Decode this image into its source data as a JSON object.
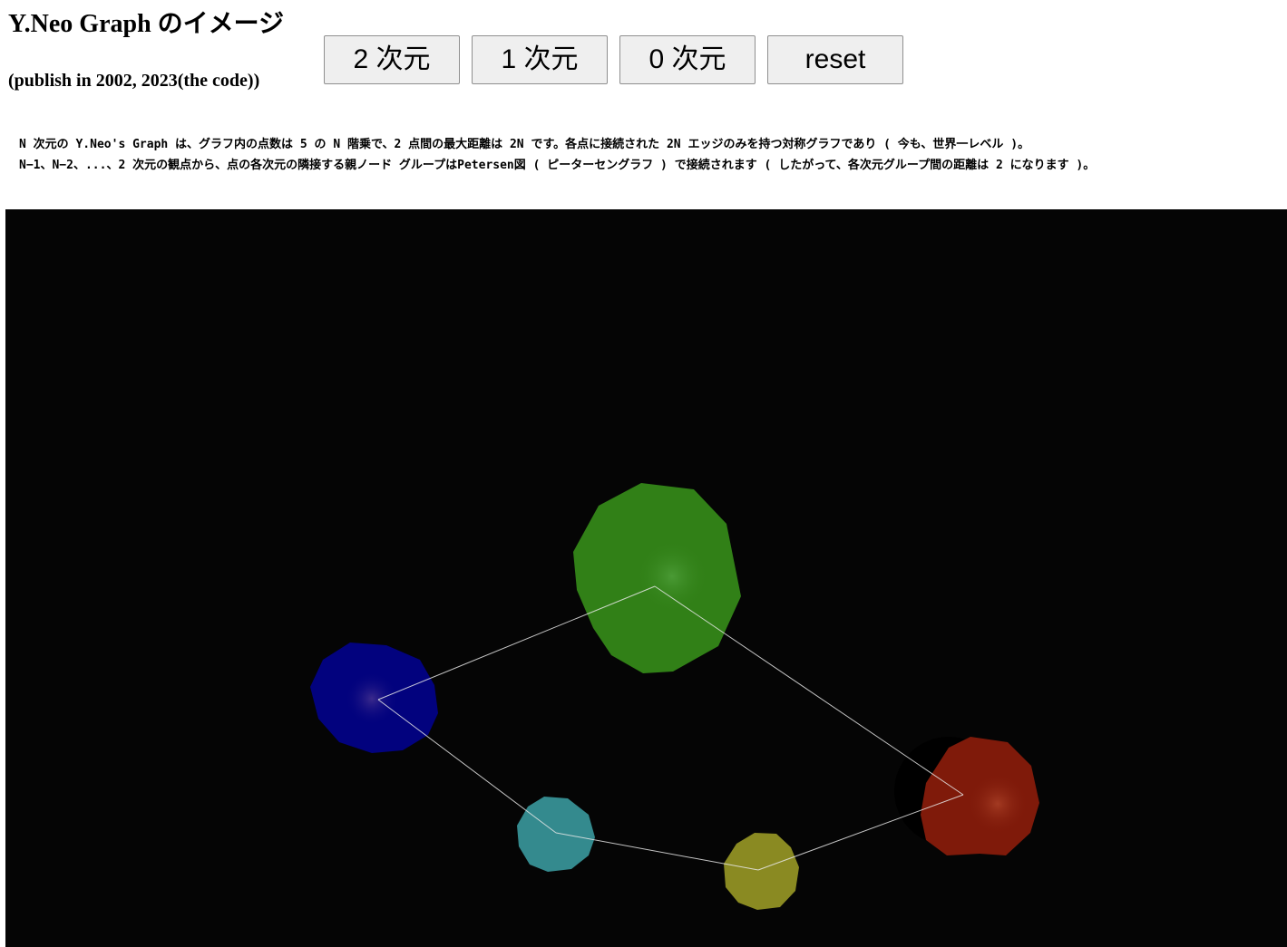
{
  "header": {
    "title": "Y.Neo Graph のイメージ",
    "subtitle": "(publish in 2002, 2023(the code))"
  },
  "controls": {
    "buttons": [
      {
        "label": "2 次元"
      },
      {
        "label": "1 次元"
      },
      {
        "label": "0 次元"
      },
      {
        "label": "reset"
      }
    ]
  },
  "description": {
    "line1": "N 次元の Y.Neo's Graph は、グラフ内の点数は 5 の N 階乗で、2 点間の最大距離は 2N です。各点に接続された 2N エッジのみを持つ対称グラフであり ( 今も、世界一レベル )。",
    "line2": "N−1、N−2、...、2 次元の観点から、点の各次元の隣接する親ノード グループはPetersen図 ( ピーターセングラフ ) で接続されます ( したがって、各次元グループ間の距離は 2 になります )。"
  },
  "graph": {
    "background": "#050505",
    "edge_color": "#e8e8e8",
    "nodes": [
      {
        "id": "green",
        "color": "#318017"
      },
      {
        "id": "blue",
        "color": "#02027e"
      },
      {
        "id": "cyan",
        "color": "#348a8e"
      },
      {
        "id": "yellow",
        "color": "#8a8a22"
      },
      {
        "id": "red",
        "color": "#7f1a0a"
      }
    ],
    "edges": [
      [
        "green",
        "blue"
      ],
      [
        "blue",
        "cyan"
      ],
      [
        "cyan",
        "yellow"
      ],
      [
        "yellow",
        "red"
      ],
      [
        "red",
        "green"
      ]
    ]
  }
}
